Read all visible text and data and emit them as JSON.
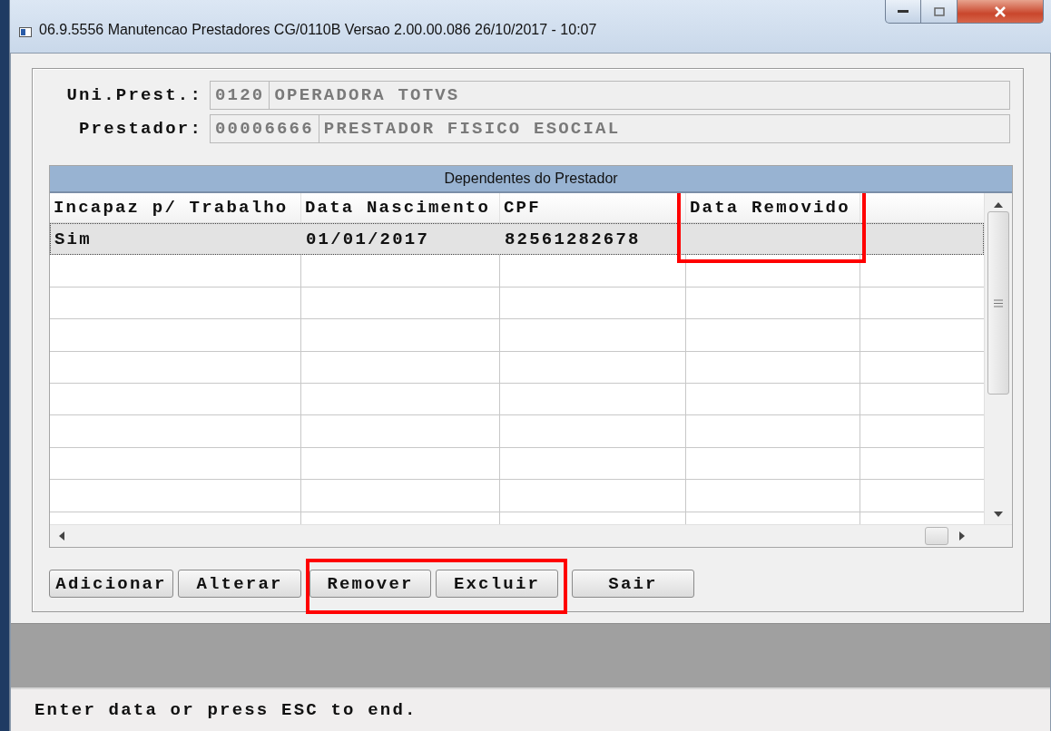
{
  "window": {
    "title": "06.9.5556 Manutencao  Prestadores CG/0110B Versao 2.00.00.086 26/10/2017 - 10:07"
  },
  "fields": [
    {
      "label": "Uni.Prest.:",
      "code": "0120",
      "name": "OPERADORA TOTVS"
    },
    {
      "label": "Prestador:",
      "code": "00006666",
      "name": "PRESTADOR FISICO ESOCIAL"
    }
  ],
  "browse": {
    "title": "Dependentes do Prestador",
    "columns": [
      {
        "label": "Incapaz p/ Trabalho",
        "highlighted": false
      },
      {
        "label": "Data Nascimento",
        "highlighted": false
      },
      {
        "label": "CPF",
        "highlighted": false
      },
      {
        "label": "Data Removido",
        "highlighted": true
      }
    ],
    "rows": [
      {
        "selected": true,
        "cells": [
          "Sim",
          "01/01/2017",
          "82561282678"
        ]
      }
    ]
  },
  "buttons": [
    {
      "label": "Adicionar",
      "highlighted": false
    },
    {
      "label": "Alterar",
      "highlighted": false
    },
    {
      "label": "Remover",
      "highlighted": true
    },
    {
      "label": "Excluir",
      "highlighted": true
    },
    {
      "label": "Sair",
      "highlighted": false
    }
  ],
  "status_bar": "Enter data or press ESC to end."
}
